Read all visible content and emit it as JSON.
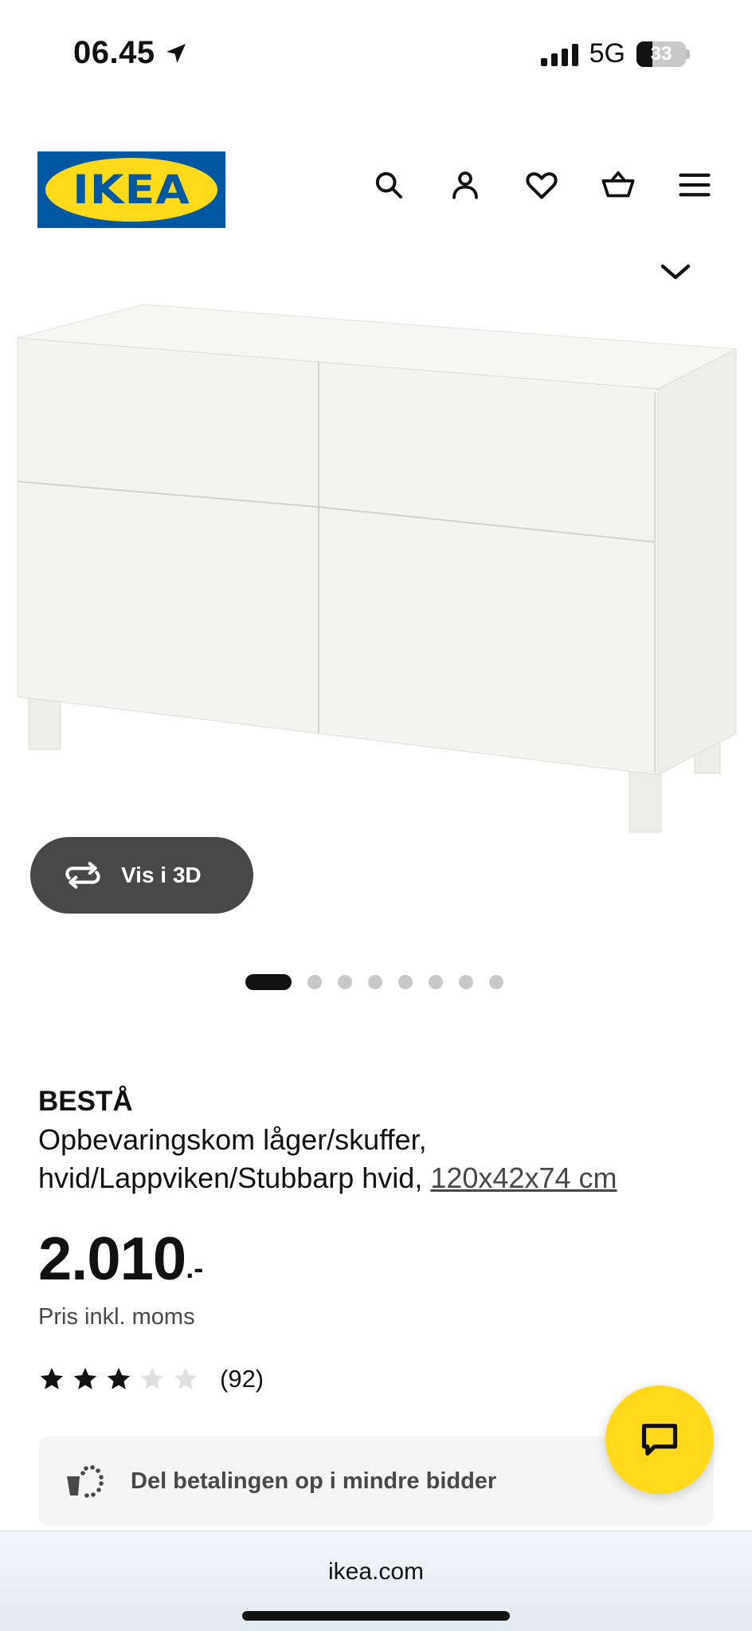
{
  "status_bar": {
    "time": "06.45",
    "network": "5G",
    "battery": "33",
    "battery_level": 0.33
  },
  "header": {
    "logo_text": "IKEA",
    "icons": [
      "search-icon",
      "user-icon",
      "heart-icon",
      "basket-icon",
      "menu-icon"
    ]
  },
  "gallery": {
    "view_3d_label": "Vis i 3D",
    "dots_total": 8,
    "active_dot": 1
  },
  "product": {
    "name": "BESTÅ",
    "description": "Opbevaringskom låger/skuffer, hvid/Lappviken/Stubbarp hvid,",
    "dimensions": "120x42x74 cm",
    "price": "2.010",
    "price_suffix": ".-",
    "price_note": "Pris inkl. moms",
    "rating_stars": 3,
    "rating_max": 5,
    "rating_count": "(92)"
  },
  "payment_banner": {
    "text": "Del betalingen op i mindre bidder"
  },
  "browser": {
    "url": "ikea.com"
  },
  "colors": {
    "ikea_blue": "#0058a3",
    "ikea_yellow": "#ffda1a",
    "chat_yellow": "#ffd91a",
    "dark_button": "#484848"
  }
}
